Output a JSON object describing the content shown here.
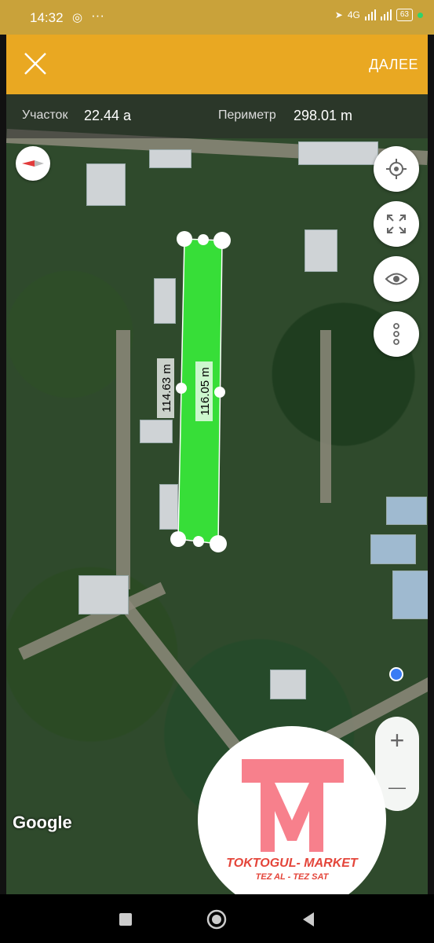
{
  "status_bar": {
    "time": "14:32",
    "network": "4G",
    "battery": "63"
  },
  "app_bar": {
    "next_label": "ДАЛЕЕ"
  },
  "measurements": {
    "area_label": "Участок",
    "area_value": "22.44 а",
    "perimeter_label": "Периметр",
    "perimeter_value": "298.01 m",
    "side_left": "114.63 m",
    "side_right": "116.05 m"
  },
  "map": {
    "attribution": "Google",
    "zoom_in": "+",
    "zoom_out": "—"
  },
  "watermark": {
    "brand": "TOKTOGUL- MARKET",
    "slogan": "TEZ AL - TEZ SAT"
  },
  "colors": {
    "app_bar": "#e9a822",
    "plot_fill": "#39ff3a",
    "logo": "#f7808c"
  },
  "icons": [
    "close-icon",
    "compass-icon",
    "target-icon",
    "expand-icon",
    "eye-icon",
    "more-vertical-icon",
    "home-icon",
    "back-icon",
    "recent-apps-icon"
  ]
}
